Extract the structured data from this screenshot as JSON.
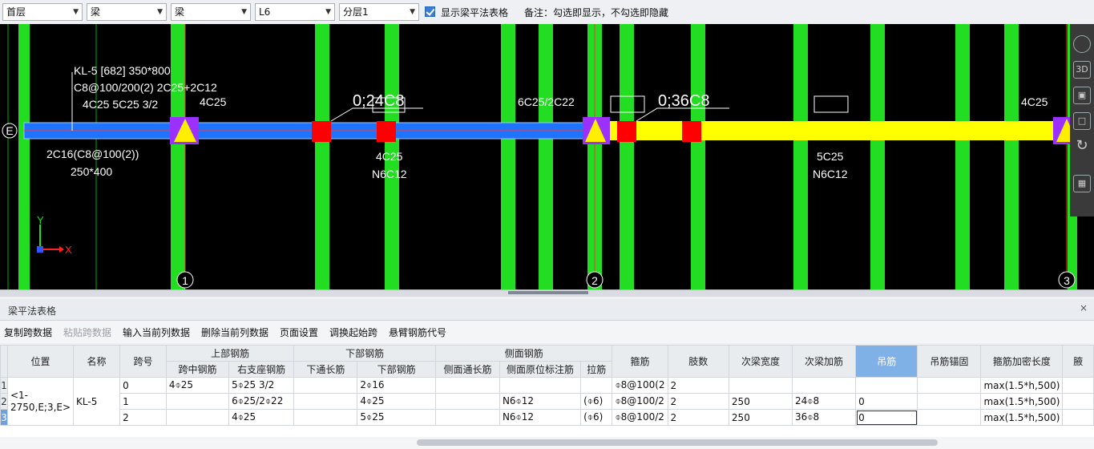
{
  "toolbar": {
    "floor": "首层",
    "type": "梁",
    "subtype": "梁",
    "member": "L6",
    "layer": "分层1",
    "show_table_label": "显示梁平法表格",
    "show_table_checked": true,
    "note": "备注：勾选即显示，不勾选即隐藏"
  },
  "canvas": {
    "axis_e": "E",
    "axis_1": "1",
    "axis_2": "2",
    "axis_3": "3",
    "ucs_y": "Y",
    "ucs_x": "X",
    "beam_label_lines": [
      "KL-5 [682] 350*800",
      "C8@100/200(2) 2C25+2C12",
      "4C25   5C25 3/2"
    ],
    "left_support_top": "4C25",
    "left_bottom_lines": [
      "2C16(C8@100(2))",
      "250*400"
    ],
    "hanger_1": "0;24C8",
    "hanger_2": "0;36C8",
    "support2_top": "6C25/2C22",
    "right_end_top": "4C25",
    "span1_bottom": [
      "4C25",
      "N6C12"
    ],
    "span2_bottom": [
      "5C25",
      "N6C12"
    ],
    "colors": {
      "background": "#000000",
      "column": "#22dd22",
      "beam_span1": "#1e74ff",
      "beam_span2": "#ffff00",
      "support": "#9b30ff",
      "hanger": "#ff0000"
    },
    "right_panel_icons": [
      "sphere-view-icon",
      "3d-view-icon",
      "cube-icon",
      "cube-outline-icon",
      "rotate-icon",
      "grid-icon"
    ]
  },
  "panel": {
    "title": "梁平法表格",
    "close": "×",
    "actions": [
      {
        "label": "复制跨数据",
        "enabled": true
      },
      {
        "label": "粘贴跨数据",
        "enabled": false
      },
      {
        "label": "输入当前列数据",
        "enabled": true
      },
      {
        "label": "删除当前列数据",
        "enabled": true
      },
      {
        "label": "页面设置",
        "enabled": true
      },
      {
        "label": "调换起始跨",
        "enabled": true
      },
      {
        "label": "悬臂钢筋代号",
        "enabled": true
      }
    ]
  },
  "table": {
    "group_headers": {
      "top": "上部钢筋",
      "bottom": "下部钢筋",
      "side": "侧面钢筋"
    },
    "headers": {
      "position": "位置",
      "name": "名称",
      "span": "跨号",
      "top_mid": "跨中钢筋",
      "top_right": "右支座钢筋",
      "bot_through": "下通长筋",
      "bot_bar": "下部钢筋",
      "side_through": "侧面通长筋",
      "side_orig": "侧面原位标注筋",
      "tie": "拉筋",
      "stirrup": "箍筋",
      "legs": "肢数",
      "sec_width": "次梁宽度",
      "sec_add": "次梁加筋",
      "hanger": "吊筋",
      "hanger_anchor": "吊筋锚固",
      "stirrup_len": "箍筋加密长度",
      "extra": "腋"
    },
    "row_numbers": [
      "1",
      "2",
      "3"
    ],
    "position_value": "<1-2750,E;3,E>",
    "name_value": "KL-5",
    "rows": [
      {
        "span": "0",
        "top_mid": "4⌽25",
        "top_right": "5⌽25 3/2",
        "bot_through": "",
        "bot_bar": "2⌽16",
        "side_through": "",
        "side_orig": "",
        "tie": "",
        "stirrup": "⌽8@100(2",
        "legs": "2",
        "sec_width": "",
        "sec_add": "",
        "hanger": "",
        "hanger_anchor": "",
        "stirrup_len": "max(1.5*h,500)"
      },
      {
        "span": "1",
        "top_mid": "",
        "top_right": "6⌽25/2⌽22",
        "bot_through": "",
        "bot_bar": "4⌽25",
        "side_through": "",
        "side_orig": "N6⌽12",
        "tie": "(⌽6)",
        "stirrup": "⌽8@100/2",
        "legs": "2",
        "sec_width": "250",
        "sec_add": "24⌽8",
        "hanger": "0",
        "hanger_anchor": "",
        "stirrup_len": "max(1.5*h,500)"
      },
      {
        "span": "2",
        "top_mid": "",
        "top_right": "4⌽25",
        "bot_through": "",
        "bot_bar": "5⌽25",
        "side_through": "",
        "side_orig": "N6⌽12",
        "tie": "(⌽6)",
        "stirrup": "⌽8@100/2",
        "legs": "2",
        "sec_width": "250",
        "sec_add": "36⌽8",
        "hanger": "0",
        "hanger_anchor": "",
        "stirrup_len": "max(1.5*h,500)"
      }
    ]
  }
}
